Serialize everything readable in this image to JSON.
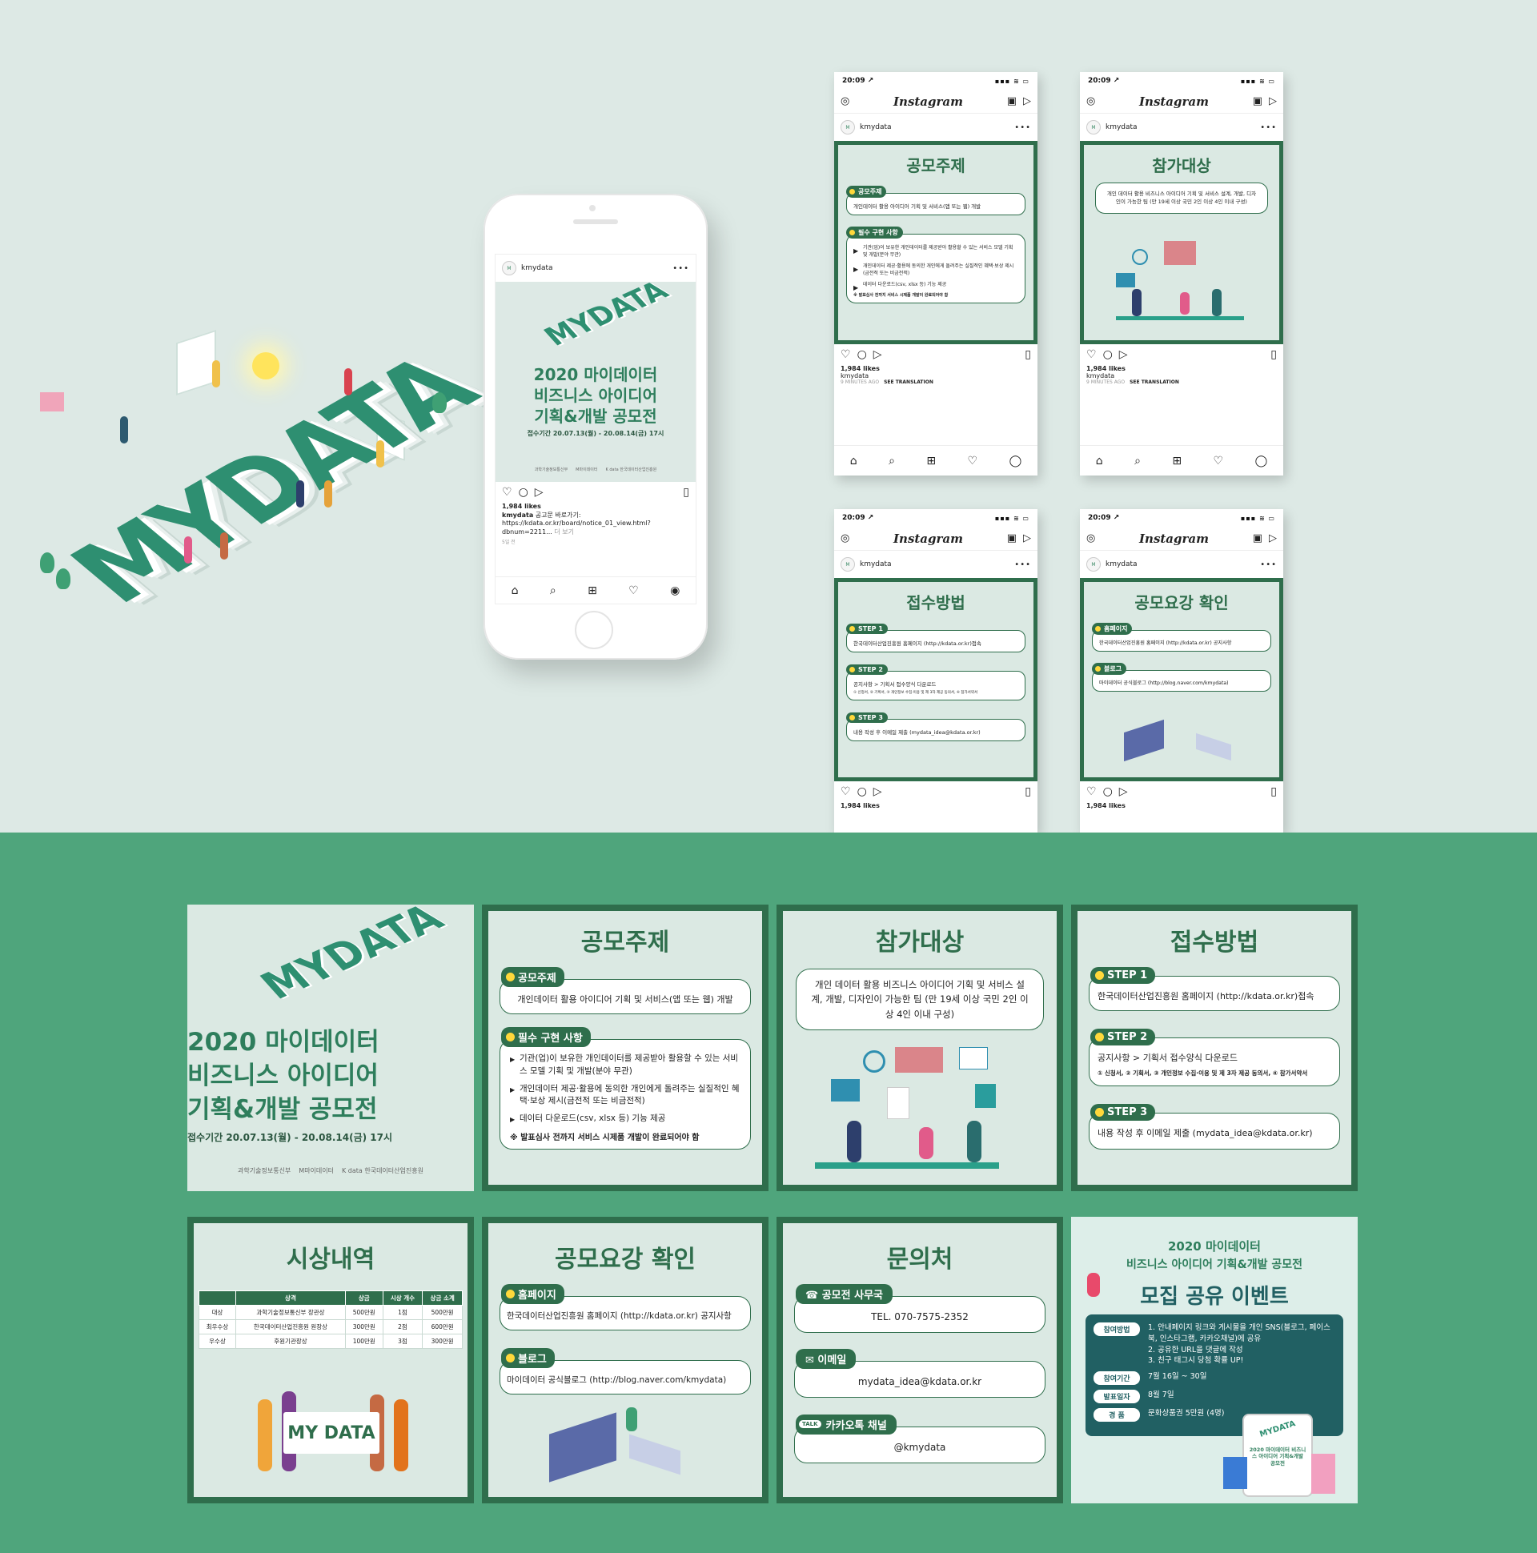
{
  "brand_word": "MYDATA",
  "phone": {
    "username": "kmydata",
    "avatar_text": "M",
    "poster": {
      "word": "MYDATA",
      "title_lines": [
        "2020 마이데이터",
        "비즈니스 아이디어",
        "기획&개발 공모전"
      ],
      "period": "접수기간 20.07.13(월) - 20.08.14(금) 17시",
      "logos": [
        "과학기술정보통신부",
        "M마이데이터",
        "K data 한국데이터산업진흥원"
      ]
    },
    "likes": "1,984 likes",
    "caption_user": "kmydata",
    "caption_text": "공고문 바로가기: https://kdata.or.kr/board/notice_01_view.html?dbnum=2211...",
    "caption_more": "더 보기",
    "time": "5일 전"
  },
  "ig": {
    "time": "20:09 ↗",
    "signal": "▪▪▪ ≋ ▭",
    "logo": "Instagram",
    "username": "kmydata",
    "avatar_text": "M",
    "likes": "1,984 likes",
    "caption_user": "kmydata",
    "meta_time": "9 MINUTES AGO",
    "meta_translate": "SEE TRANSLATION"
  },
  "cards": {
    "topic": {
      "title": "공모주제",
      "tag1": "공모주제",
      "box1": "개인데이터 활용 아이디어 기획 및 서비스(앱 또는 웹) 개발",
      "tag2": "필수 구현 사항",
      "items": [
        "기관(업)이 보유한 개인데이터를 제공받아 활용할 수 있는 서비스 모델 기획 및 개발(분야 무관)",
        "개인데이터 제공·활용에 동의한 개인에게 돌려주는 실질적인 혜택·보상 제시(금전적 또는 비금전적)",
        "데이터 다운로드(csv, xlsx 등) 기능 제공"
      ],
      "note": "※ 발표심사 전까지 서비스 시제품 개발이 완료되어야 함"
    },
    "target": {
      "title": "참가대상",
      "box": "개인 데이터 활용 비즈니스 아이디어 기획 및 서비스 설계, 개발, 디자인이 가능한 팀 (만 19세 이상 국민 2인 이상 4인 이내 구성)"
    },
    "apply": {
      "title": "접수방법",
      "step1_tag": "STEP 1",
      "step1": "한국데이터산업진흥원 홈페이지 (http://kdata.or.kr)접속",
      "step2_tag": "STEP 2",
      "step2": "공지사항 > 기획서 접수양식 다운로드",
      "step2_sub": "① 신청서, ② 기획서, ③ 개인정보 수집·이용 및 제 3자 제공 동의서, ④ 참가서약서",
      "step3_tag": "STEP 3",
      "step3": "내용 작성 후 이메일 제출 (mydata_idea@kdata.or.kr)"
    },
    "guide": {
      "title": "공모요강 확인",
      "tag1": "홈페이지",
      "box1": "한국데이터산업진흥원 홈페이지 (http://kdata.or.kr) 공지사항",
      "tag2": "블로그",
      "box2": "마이데이터 공식블로그 (http://blog.naver.com/kmydata)"
    },
    "poster": {
      "word": "MYDATA",
      "title_lines": [
        "2020 마이데이터",
        "비즈니스 아이디어",
        "기획&개발 공모전"
      ],
      "period": "접수기간 20.07.13(월) - 20.08.14(금) 17시",
      "logos": [
        "과학기술정보통신부",
        "M마이데이터",
        "K data 한국데이터산업진흥원"
      ]
    },
    "awards": {
      "title": "시상내역",
      "headers": [
        "",
        "상격",
        "상금",
        "시상 개수",
        "상금 소계"
      ],
      "rows": [
        [
          "대상",
          "과학기술정보통신부 장관상",
          "500만원",
          "1점",
          "500만원"
        ],
        [
          "최우수상",
          "한국데이터산업진흥원 원장상",
          "300만원",
          "2점",
          "600만원"
        ],
        [
          "우수상",
          "후원기관장상",
          "100만원",
          "3점",
          "300만원"
        ]
      ],
      "sign": "MY DATA"
    },
    "contact": {
      "title": "문의처",
      "tag1": "☎ 공모전 사무국",
      "box1": "TEL. 070-7575-2352",
      "tag2": "✉ 이메일",
      "box2": "mydata_idea@kdata.or.kr",
      "tag3": "카카오톡 채널",
      "tag3_icon": "TALK",
      "box3": "@kmydata"
    },
    "event": {
      "line1": "2020 마이데이터",
      "line2": "비즈니스 아이디어 기획&개발 공모전",
      "title": "모집 공유 이벤트",
      "rows": [
        {
          "label": "참여방법",
          "text": "1. 안내페이지 링크와 게시물을 개인 SNS(블로그, 페이스북, 인스타그램, 카카오채널)에 공유\n2. 공유한 URL을 댓글에 작성\n3. 친구 태그시 당첨 확률 UP!"
        },
        {
          "label": "참여기간",
          "text": "7월 16일 ~ 30일"
        },
        {
          "label": "발표일자",
          "text": "8월 7일"
        },
        {
          "label": "경 품",
          "text": "문화상품권 5만원 (4명)"
        }
      ],
      "mini_word": "MYDATA",
      "mini_title": "2020 마이데이터 비즈니스 아이디어 기획&개발 공모전"
    }
  },
  "colors": {
    "primary": "#2f6e4c",
    "accent_green": "#4fa57c",
    "background": "#dde9e5",
    "bulb": "#ffd83b"
  }
}
